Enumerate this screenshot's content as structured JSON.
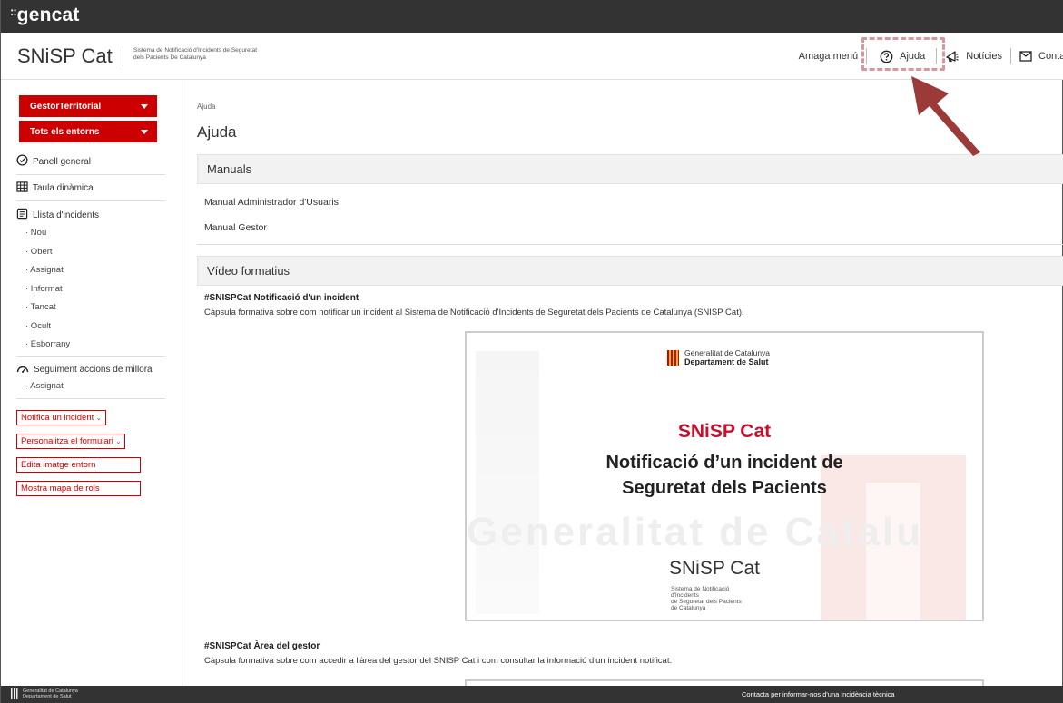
{
  "topbar": {
    "logo": "gencat",
    "logo_prefix": "::"
  },
  "header": {
    "brand": "SNiSP Cat",
    "brand_subtitle_line1": "Sistema de Notificació d'Incidents de Seguretat",
    "brand_subtitle_line2": "dels Pacients De Catalunya",
    "nav": {
      "hide_menu": "Amaga menú",
      "help": "Ajuda",
      "news": "Notícies",
      "contact": "Contacte"
    }
  },
  "sidebar": {
    "selects": [
      {
        "label": "GestorTerritorial"
      },
      {
        "label": "Tots els entorns"
      }
    ],
    "menu": {
      "general_panel": "Panell general",
      "pivot_table": "Taula dinàmica",
      "incident_list": "Llista d'incidents",
      "incident_states": [
        "· Nou",
        "· Obert",
        "· Assignat",
        "· Informat",
        "· Tancat",
        "· Ocult",
        "· Esborrany"
      ],
      "improvement_actions": "Seguiment accions de millora",
      "improvement_states": [
        "· Assignat"
      ]
    },
    "buttons": {
      "notify_incident": "Notifica un incident",
      "customize_form": "Personalitza el formulari",
      "edit_image": "Edita imatge entorn",
      "show_roles": "Mostra mapa de rols"
    }
  },
  "main": {
    "breadcrumb": "Ajuda",
    "title": "Ajuda",
    "manuals": {
      "heading": "Manuals",
      "items": [
        "Manual Administrador d'Usuaris",
        "Manual Gestor"
      ]
    },
    "videos": {
      "heading": "Vídeo formatius",
      "items": [
        {
          "title": "#SNISPCat Notificació d'un incident",
          "description": "Càpsula formativa sobre com notificar un incident al Sistema de Notificació d'Incidents de Seguretat dels Pacients de Catalunya (SNISP Cat)."
        },
        {
          "title": "#SNISPCat Àrea del gestor",
          "description": "Càpsula formativa sobre com accedir a l'àrea del gestor del SNISP Cat i com consultar la informació d'un incident notificat."
        }
      ],
      "thumbnail": {
        "gov_line1": "Generalitat de Catalunya",
        "gov_line2": "Departament de Salut",
        "title": "SNiSP Cat",
        "subtitle_line1": "Notificació d’un incident de",
        "subtitle_line2": "Seguretat dels Pacients",
        "background_word": "Generalitat de Catalu",
        "brand": "SNiSP Cat",
        "brand_sub1": "Sistema de Notificació d'Incidents",
        "brand_sub2": "de Seguretat dels Pacients",
        "brand_sub3": "de Catalunya"
      }
    }
  },
  "footer": {
    "gov_line1": "Generalitat de Catalunya",
    "gov_line2": "Departament de Salut",
    "contact_text": "Contacta per informar-nos d'una incidència tècnica"
  },
  "colors": {
    "accent_red": "#cc0000",
    "topbar": "#333333",
    "highlight_dash": "#d9969b",
    "arrow": "#9c3a3a"
  }
}
